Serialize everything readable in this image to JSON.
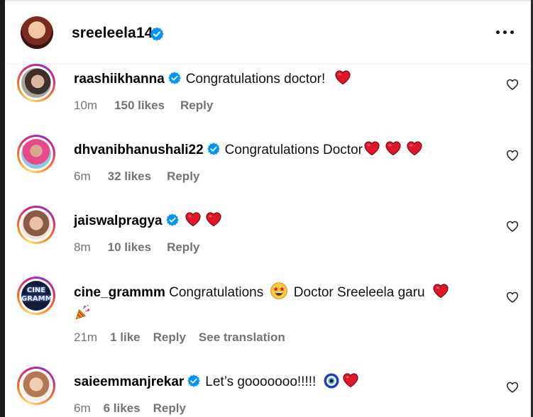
{
  "post_author": {
    "username": "sreeleela14",
    "verified": true
  },
  "icons": {
    "verified": "verified-badge-icon",
    "more": "more-options-icon",
    "like": "heart-outline-icon"
  },
  "colors": {
    "verified_blue": "#0095f6",
    "heart_red": "#e0162b",
    "meta_gray": "#737373"
  },
  "comments": [
    {
      "username": "raashiikhanna",
      "verified": true,
      "text": "Congratulations doctor!",
      "emoji": [
        "red-heart"
      ],
      "time": "10m",
      "likes": "150 likes",
      "reply": "Reply"
    },
    {
      "username": "dhvanibhanushali22",
      "verified": true,
      "text": "Congratulations Doctor",
      "emoji": [
        "red-heart",
        "red-heart",
        "red-heart"
      ],
      "time": "6m",
      "likes": "32 likes",
      "reply": "Reply"
    },
    {
      "username": "jaiswalpragya",
      "verified": true,
      "text": "",
      "emoji": [
        "red-heart",
        "red-heart"
      ],
      "time": "8m",
      "likes": "10 likes",
      "reply": "Reply"
    },
    {
      "username": "cine_grammm",
      "verified": false,
      "text_part1": "Congratulations",
      "text_part2": "Doctor Sreeleela garu",
      "emoji": [
        "star-struck",
        "red-heart",
        "party-popper"
      ],
      "time": "21m",
      "likes": "1 like",
      "reply": "Reply",
      "translation": "See translation",
      "avatar_text": "CINE GRAMMM"
    },
    {
      "username": "saieemmanjrekar",
      "verified": true,
      "text": "Let’s gooooooo!!!!!",
      "emoji": [
        "nazar-amulet",
        "red-heart"
      ],
      "time": "6m",
      "likes": "6 likes",
      "reply": "Reply"
    }
  ]
}
